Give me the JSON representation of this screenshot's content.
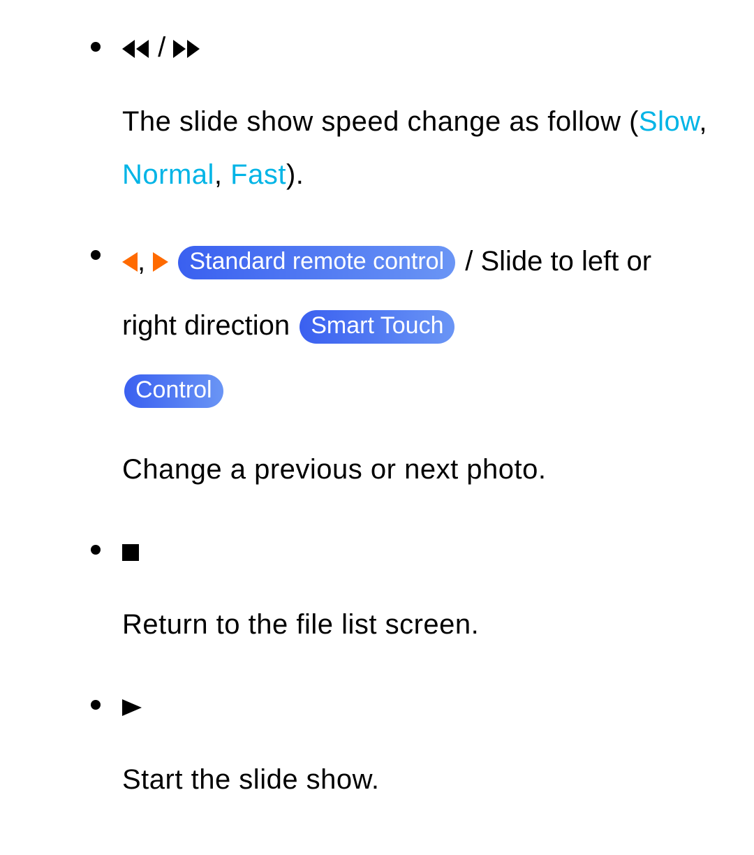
{
  "items": [
    {
      "icon_sep": "/",
      "desc_before": "The slide show speed change as follow (",
      "speed_slow": "Slow",
      "sep1": ", ",
      "speed_normal": "Normal",
      "sep2": ", ",
      "speed_fast": "Fast",
      "desc_after": ")."
    },
    {
      "arrow_sep": ",",
      "pill_std": "Standard remote control",
      "text_mid1": " / Slide to left or right direction ",
      "pill_stc1": "Smart Touch",
      "pill_stc2": "Control",
      "desc": "Change a previous or next photo."
    },
    {
      "desc": "Return to the file list screen."
    },
    {
      "desc": "Start the slide show."
    }
  ]
}
